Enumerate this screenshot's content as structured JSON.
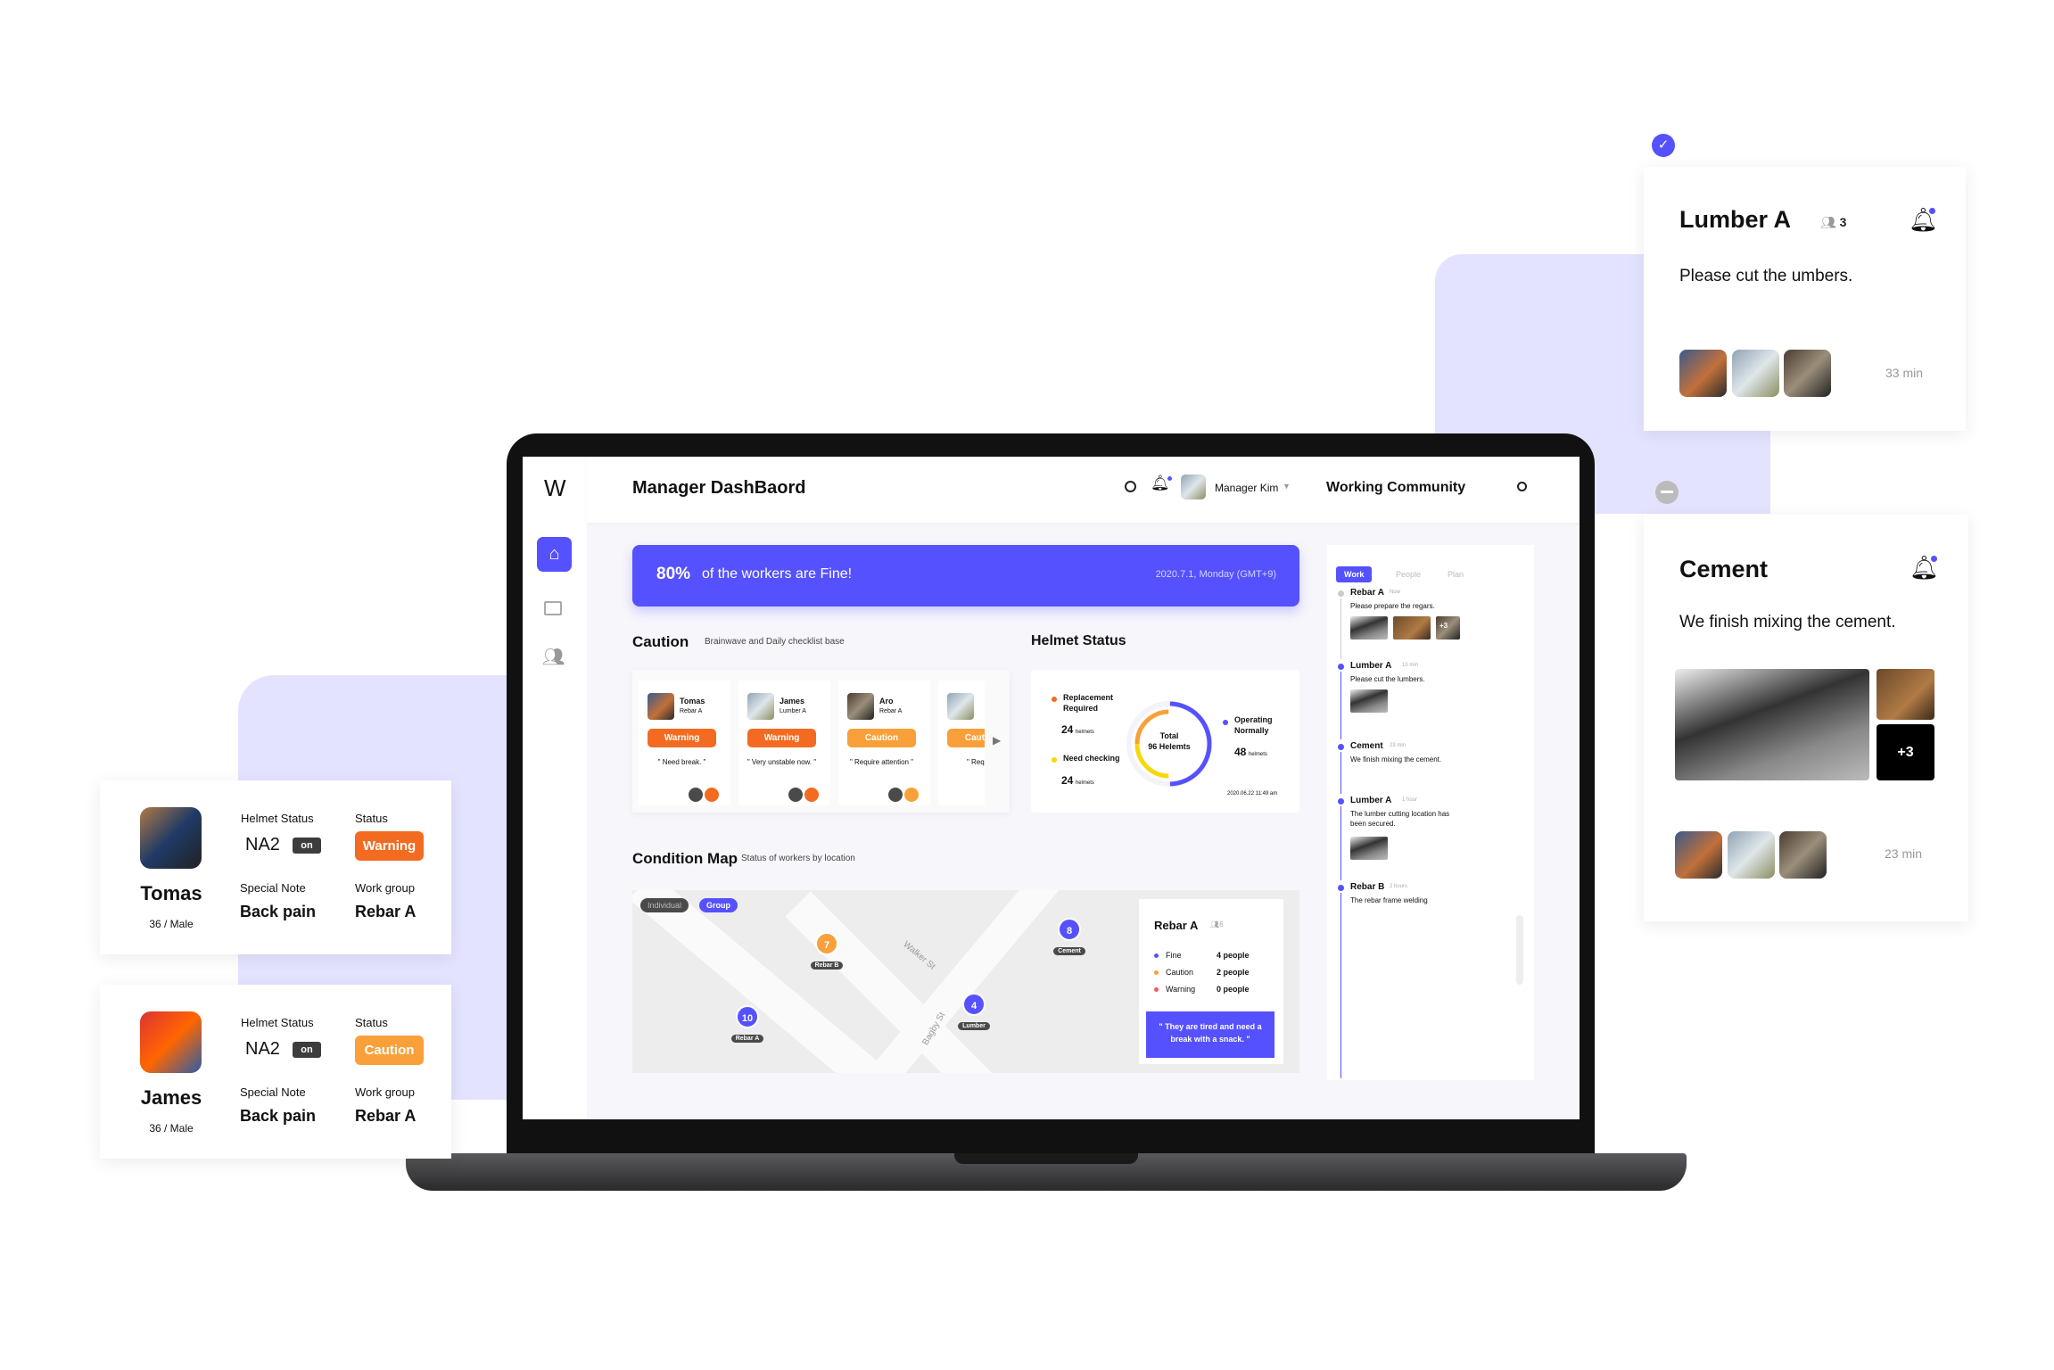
{
  "colors": {
    "accent": "#5551FF",
    "warning": "#F26B21",
    "caution": "#F9A03A",
    "need_checking": "#F5D90A",
    "lavender": "#E4E3FF"
  },
  "dashboard": {
    "logo": "W",
    "title": "Manager DashBaord",
    "user": "Manager Kim",
    "community_title": "Working Community",
    "sidebar": [
      "home-icon",
      "chat-icon",
      "people-icon"
    ],
    "banner": {
      "percent": "80%",
      "text": "of the workers are Fine!",
      "date": "2020.7.1, Monday (GMT+9)"
    },
    "caution": {
      "title": "Caution",
      "subtitle": "Brainwave and Daily checklist base",
      "cards": [
        {
          "name": "Tomas",
          "group": "Rebar A",
          "status": "Warning",
          "note": "\" Need break. \""
        },
        {
          "name": "James",
          "group": "Lumber A",
          "status": "Warning",
          "note": "\" Very unstable now. \""
        },
        {
          "name": "Aro",
          "group": "Rebar A",
          "status": "Caution",
          "note": "\" Require attention \""
        },
        {
          "name": "",
          "group": "",
          "status": "Caution",
          "note": "\" Require"
        }
      ]
    },
    "helmet": {
      "title": "Helmet Status",
      "total_label": "Total",
      "total": "96 Helemts",
      "replacement_label": "Replacement Required",
      "replacement": "24",
      "need_label": "Need checking",
      "need": "24",
      "normal_label": "Operating Normally",
      "normal": "48",
      "unit": "helmets",
      "timestamp": "2020.06.22 11:49 am",
      "values": {
        "replacement": 24,
        "need_checking": 24,
        "normal": 48
      }
    },
    "map": {
      "title": "Condition Map",
      "subtitle": "Status of workers by location",
      "toggle_individual": "Individual",
      "toggle_group": "Group",
      "streets": [
        "Walker St",
        "Bagby St"
      ],
      "pins": [
        {
          "count": "7",
          "label": "Rebar B"
        },
        {
          "count": "8",
          "label": "Cement"
        },
        {
          "count": "10",
          "label": "Rebar A"
        },
        {
          "count": "4",
          "label": "Lumber"
        }
      ],
      "info": {
        "title": "Rebar A",
        "members": "6",
        "rows": [
          {
            "label": "Fine",
            "value": "4 people"
          },
          {
            "label": "Caution",
            "value": "2 people"
          },
          {
            "label": "Warning",
            "value": "0 people"
          }
        ],
        "quote": "\" They are tired and need a break with a snack. \""
      }
    },
    "community": {
      "tabs": [
        "Work",
        "People",
        "Plan"
      ],
      "items": [
        {
          "title": "Rebar A",
          "time": "Now",
          "text": "Please prepare the regars.",
          "more": "+3"
        },
        {
          "title": "Lumber A",
          "time": "10 min",
          "text": "Please cut the lumbers."
        },
        {
          "title": "Cement",
          "time": "23 min",
          "text": "We finish mixing the cement."
        },
        {
          "title": "Lumber A",
          "time": "1 hour",
          "text": "The lumber cutting location has been secured."
        },
        {
          "title": "Rebar B",
          "time": "2 hours",
          "text": "The rebar frame welding"
        }
      ]
    }
  },
  "workers": [
    {
      "name": "Tomas",
      "info": "36 / Male",
      "helmet_label": "Helmet Status",
      "helmet": "NA2",
      "helmet_state": "on",
      "status_label": "Status",
      "status": "Warning",
      "note_label": "Special Note",
      "note": "Back pain",
      "group_label": "Work group",
      "group": "Rebar A"
    },
    {
      "name": "James",
      "info": "36 / Male",
      "helmet_label": "Helmet Status",
      "helmet": "NA2",
      "helmet_state": "on",
      "status_label": "Status",
      "status": "Caution",
      "note_label": "Special Note",
      "note": "Back pain",
      "group_label": "Work group",
      "group": "Rebar A"
    }
  ],
  "notifications": [
    {
      "title": "Lumber A",
      "members": "3",
      "text": "Please cut the umbers.",
      "time": "33 min"
    },
    {
      "title": "Cement",
      "text": "We finish mixing the cement.",
      "more": "+3",
      "time": "23 min"
    }
  ]
}
